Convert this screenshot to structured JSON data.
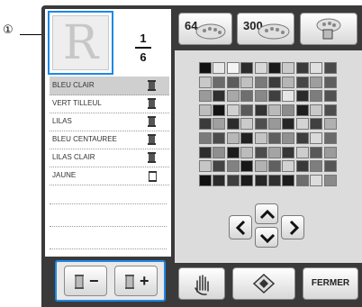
{
  "callout": {
    "number": "①"
  },
  "preview": {
    "letter": "R"
  },
  "page_indicator": {
    "current": "1",
    "total": "6"
  },
  "color_list": [
    {
      "name": "BLEU CLAIR",
      "spool": "filled",
      "selected": true
    },
    {
      "name": "VERT TILLEUL",
      "spool": "filled",
      "selected": false
    },
    {
      "name": "LILAS",
      "spool": "filled",
      "selected": false
    },
    {
      "name": "BLEU CENTAUREE",
      "spool": "filled",
      "selected": false
    },
    {
      "name": "LILAS CLAIR",
      "spool": "filled",
      "selected": false
    },
    {
      "name": "JAUNE",
      "spool": "empty",
      "selected": false
    }
  ],
  "toolbar": {
    "btn64_label": "64",
    "btn300_label": "300"
  },
  "spool_buttons": {
    "minus": "−",
    "plus": "+"
  },
  "bottom": {
    "close_label": "FERMER"
  },
  "accent_color": "#1e88e5",
  "palette": [
    [
      "#111111",
      "#e8e8e8",
      "#f4f4f4",
      "#2c2c2c",
      "#d8d8d8",
      "#1a1a1a",
      "#cacaca",
      "#3a3a3a",
      "#e0e0e0",
      "#4a4a4a"
    ],
    [
      "#c9c9c9",
      "#6b6b6b",
      "#5c5c5c",
      "#c0c0c0",
      "#7a7a7a",
      "#3c3c3c",
      "#b5b5b5",
      "#474747",
      "#9e9e9e",
      "#5e5e5e"
    ],
    [
      "#9a9a9a",
      "#2f2f2f",
      "#a8a8a8",
      "#6e6e6e",
      "#888888",
      "#3f3f3f",
      "#e6e6e6",
      "#2a2a2a",
      "#7d7d7d",
      "#515151"
    ],
    [
      "#bdbdbd",
      "#141414",
      "#d0d0d0",
      "#5a5a5a",
      "#333333",
      "#bababa",
      "#8c8c8c",
      "#1f1f1f",
      "#c8c8c8",
      "#4d4d4d"
    ],
    [
      "#3b3b3b",
      "#a0a0a0",
      "#2b2b2b",
      "#cbcbcb",
      "#4f4f4f",
      "#999999",
      "#262626",
      "#d4d4d4",
      "#404040",
      "#b0b0b0"
    ],
    [
      "#7b7b7b",
      "#4b4b4b",
      "#b7b7b7",
      "#202020",
      "#c4c4c4",
      "#5f5f5f",
      "#909090",
      "#3d3d3d",
      "#dadada",
      "#6a6a6a"
    ],
    [
      "#2e2e2e",
      "#8f8f8f",
      "#1c1c1c",
      "#bcbcbc",
      "#4c4c4c",
      "#a4a4a4",
      "#363636",
      "#cdcdcd",
      "#585858",
      "#9b9b9b"
    ],
    [
      "#c6c6c6",
      "#444444",
      "#828282",
      "#171717",
      "#b2b2b2",
      "#606060",
      "#d2d2d2",
      "#393939",
      "#7e7e7e",
      "#555555"
    ],
    [
      "#111111",
      "#2a2a2a",
      "#3e3e3e",
      "#1b1b1b",
      "#262626",
      "#303030",
      "#1d1d1d",
      "#6d6d6d",
      "#dcdcdc",
      "#8a8a8a"
    ]
  ]
}
